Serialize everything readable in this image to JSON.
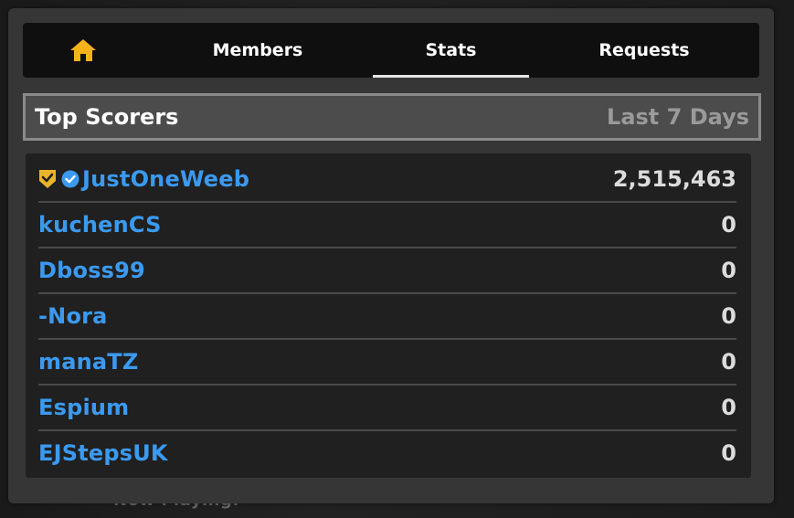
{
  "tabs": {
    "home_icon": "home-icon",
    "members": "Members",
    "stats": "Stats",
    "requests": "Requests",
    "active": "Stats"
  },
  "section": {
    "title": "Top Scorers",
    "period": "Last 7 Days"
  },
  "scorers": [
    {
      "name": "JustOneWeeb",
      "score": "2,515,463",
      "badges": [
        "shield-check-icon",
        "verified-icon"
      ]
    },
    {
      "name": "kuchenCS",
      "score": "0"
    },
    {
      "name": "Dboss99",
      "score": "0"
    },
    {
      "name": "-Nora",
      "score": "0"
    },
    {
      "name": "manaTZ",
      "score": "0"
    },
    {
      "name": "Espium",
      "score": "0"
    },
    {
      "name": "EJStepsUK",
      "score": "0"
    }
  ],
  "background_text": "Now Playing:",
  "colors": {
    "accent_home": "#f6b21a",
    "name_blue": "#3b9af0",
    "verified_blue": "#3b9af0",
    "shield_gold": "#e9b52a"
  }
}
